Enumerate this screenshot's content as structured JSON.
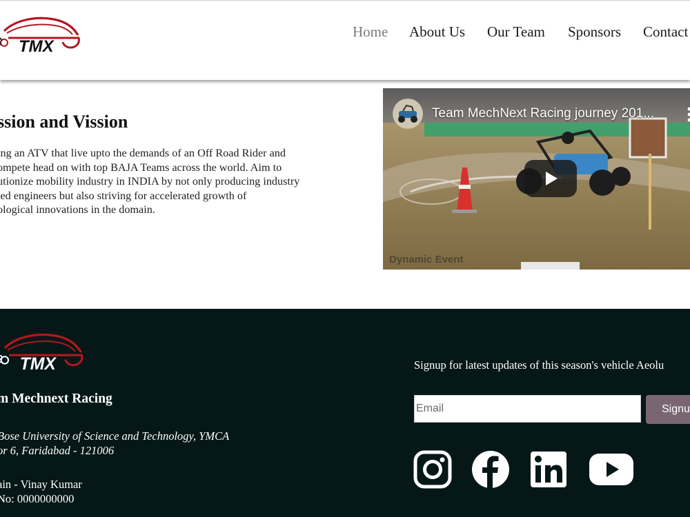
{
  "nav": {
    "items": [
      {
        "label": "Home",
        "active": true
      },
      {
        "label": "About Us",
        "active": false
      },
      {
        "label": "Our Team",
        "active": false
      },
      {
        "label": "Sponsors",
        "active": false
      },
      {
        "label": "Contact",
        "active": false
      }
    ]
  },
  "logo": {
    "text": "TMX",
    "color": "#b3171d"
  },
  "mission": {
    "title": "ssion and Vission",
    "lines": [
      "ing an ATV that live upto the demands of an Off Road Rider and",
      "ompete head on with top BAJA Teams across the world. Aim to",
      "utionize mobility industry in INDIA by not only producing industry",
      "ted engineers but also striving for accelerated growth of",
      "ological innovations in the domain."
    ]
  },
  "video": {
    "title": "Team MechNext Racing journey 201...",
    "watermark": "Dynamic Event",
    "icons": [
      "channel-avatar-icon",
      "more-vert-icon",
      "play-icon"
    ]
  },
  "footer": {
    "team_name": "m Mechnext Racing",
    "address_lines": [
      "Bose University of Science and Technology, YMCA",
      "or 6, Faridabad - 121006"
    ],
    "contact_lines": [
      "ain - Vinay Kumar",
      "No: 0000000000"
    ],
    "signup_text": "Signup for latest updates of this season's vehicle Aeolu",
    "email_placeholder": "Email",
    "signup_button": "Signu",
    "social_icons": [
      "instagram-icon",
      "facebook-icon",
      "linkedin-icon",
      "youtube-icon"
    ]
  },
  "colors": {
    "footer_bg": "#061717",
    "signup_button": "#7a6673",
    "nav_active": "#7a7a7a"
  }
}
